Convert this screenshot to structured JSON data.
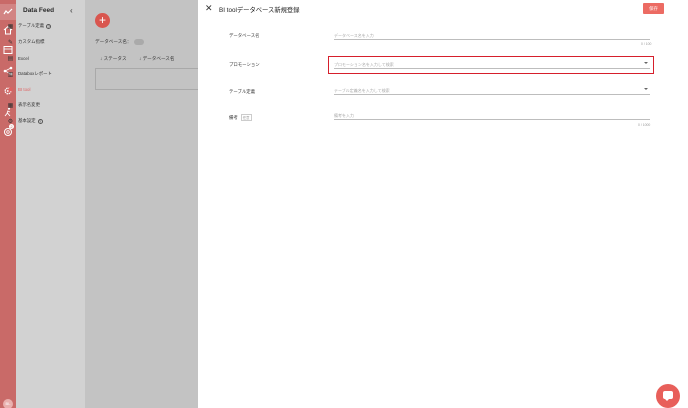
{
  "rail": {
    "icons": [
      "logo-icon",
      "home-icon",
      "layout-icon",
      "share-icon",
      "settings-icon",
      "run-icon",
      "support-icon"
    ],
    "badge": "2",
    "avatar": "BL"
  },
  "sidebar": {
    "title": "Data Feed",
    "collapse": "‹",
    "items": [
      {
        "label": "テーブル定義",
        "help": "?"
      },
      {
        "label": "カスタム指標"
      },
      {
        "label": "Excel"
      },
      {
        "label": "Databoxレポート"
      },
      {
        "label": "BI tool"
      },
      {
        "label": "表示名変更"
      },
      {
        "label": "基本設定",
        "help": "?"
      }
    ]
  },
  "list": {
    "add": "+",
    "db_label": "データベース名：",
    "col_status": "↓ ステータス",
    "col_dbname": "↓ データベース名"
  },
  "panel": {
    "close": "✕",
    "title": "BI toolデータベース新規登録",
    "save": "保存",
    "fields": {
      "dbname": {
        "label": "データベース名",
        "placeholder": "データベース名を入力",
        "counter": "0 / 100"
      },
      "promotion": {
        "label": "プロモーション",
        "placeholder": "プロモーション名を入力して検索"
      },
      "table": {
        "label": "テーブル定義",
        "placeholder": "テーブル定義名を入力して検索"
      },
      "note": {
        "label": "備考",
        "tag": "任意",
        "placeholder": "備考を入力",
        "counter": "0 / 1000"
      }
    }
  },
  "colors": {
    "accent": "#ec6b63",
    "rail": "#c96a68",
    "highlight": "#d61f2c"
  }
}
